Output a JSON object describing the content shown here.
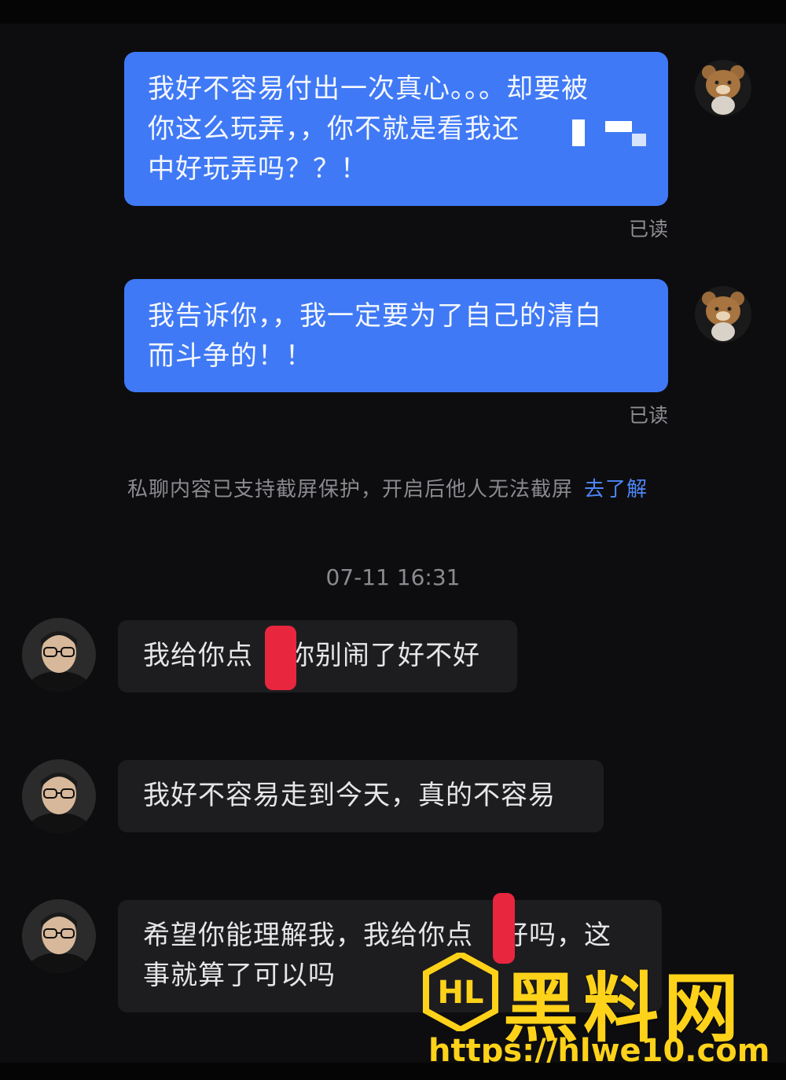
{
  "messages_out": [
    {
      "text": "我好不容易付出一次真心。。。却要被你这么玩弄，，你不就是看我还在中好玩弄吗？？！",
      "line1": "我好不容易付出一次真心。。。却要被",
      "line2": "你这么玩弄，，你不就是看我还",
      "line3": "中好玩弄吗？？！",
      "status": "已读"
    },
    {
      "line1": "我告诉你，，我一定要为了自己的清白",
      "line2": "而斗争的！！",
      "status": "已读"
    }
  ],
  "notice": {
    "text": "私聊内容已支持截屏保护，开启后他人无法截屏",
    "link": "去了解"
  },
  "timestamp": "07-11 16:31",
  "messages_in": [
    {
      "part1": "我给你点",
      "part2": "你别闹了好不好"
    },
    {
      "text": "我好不容易走到今天，真的不容易"
    },
    {
      "line1a": "希望你能理解我，我给你点",
      "line1b": "好吗，这",
      "line2": "事就算了可以吗"
    }
  ],
  "watermark": {
    "brand": "黑料网",
    "url": "https://hlwe10.com",
    "logo_letters": "HL"
  },
  "colors": {
    "out_bubble": "#3f79f5",
    "in_bubble": "#1d1d20",
    "link": "#4d86f7",
    "watermark": "#ffd21a"
  },
  "icons": {
    "self_avatar": "bear-avatar-icon",
    "contact_avatar": "man-avatar-icon"
  }
}
